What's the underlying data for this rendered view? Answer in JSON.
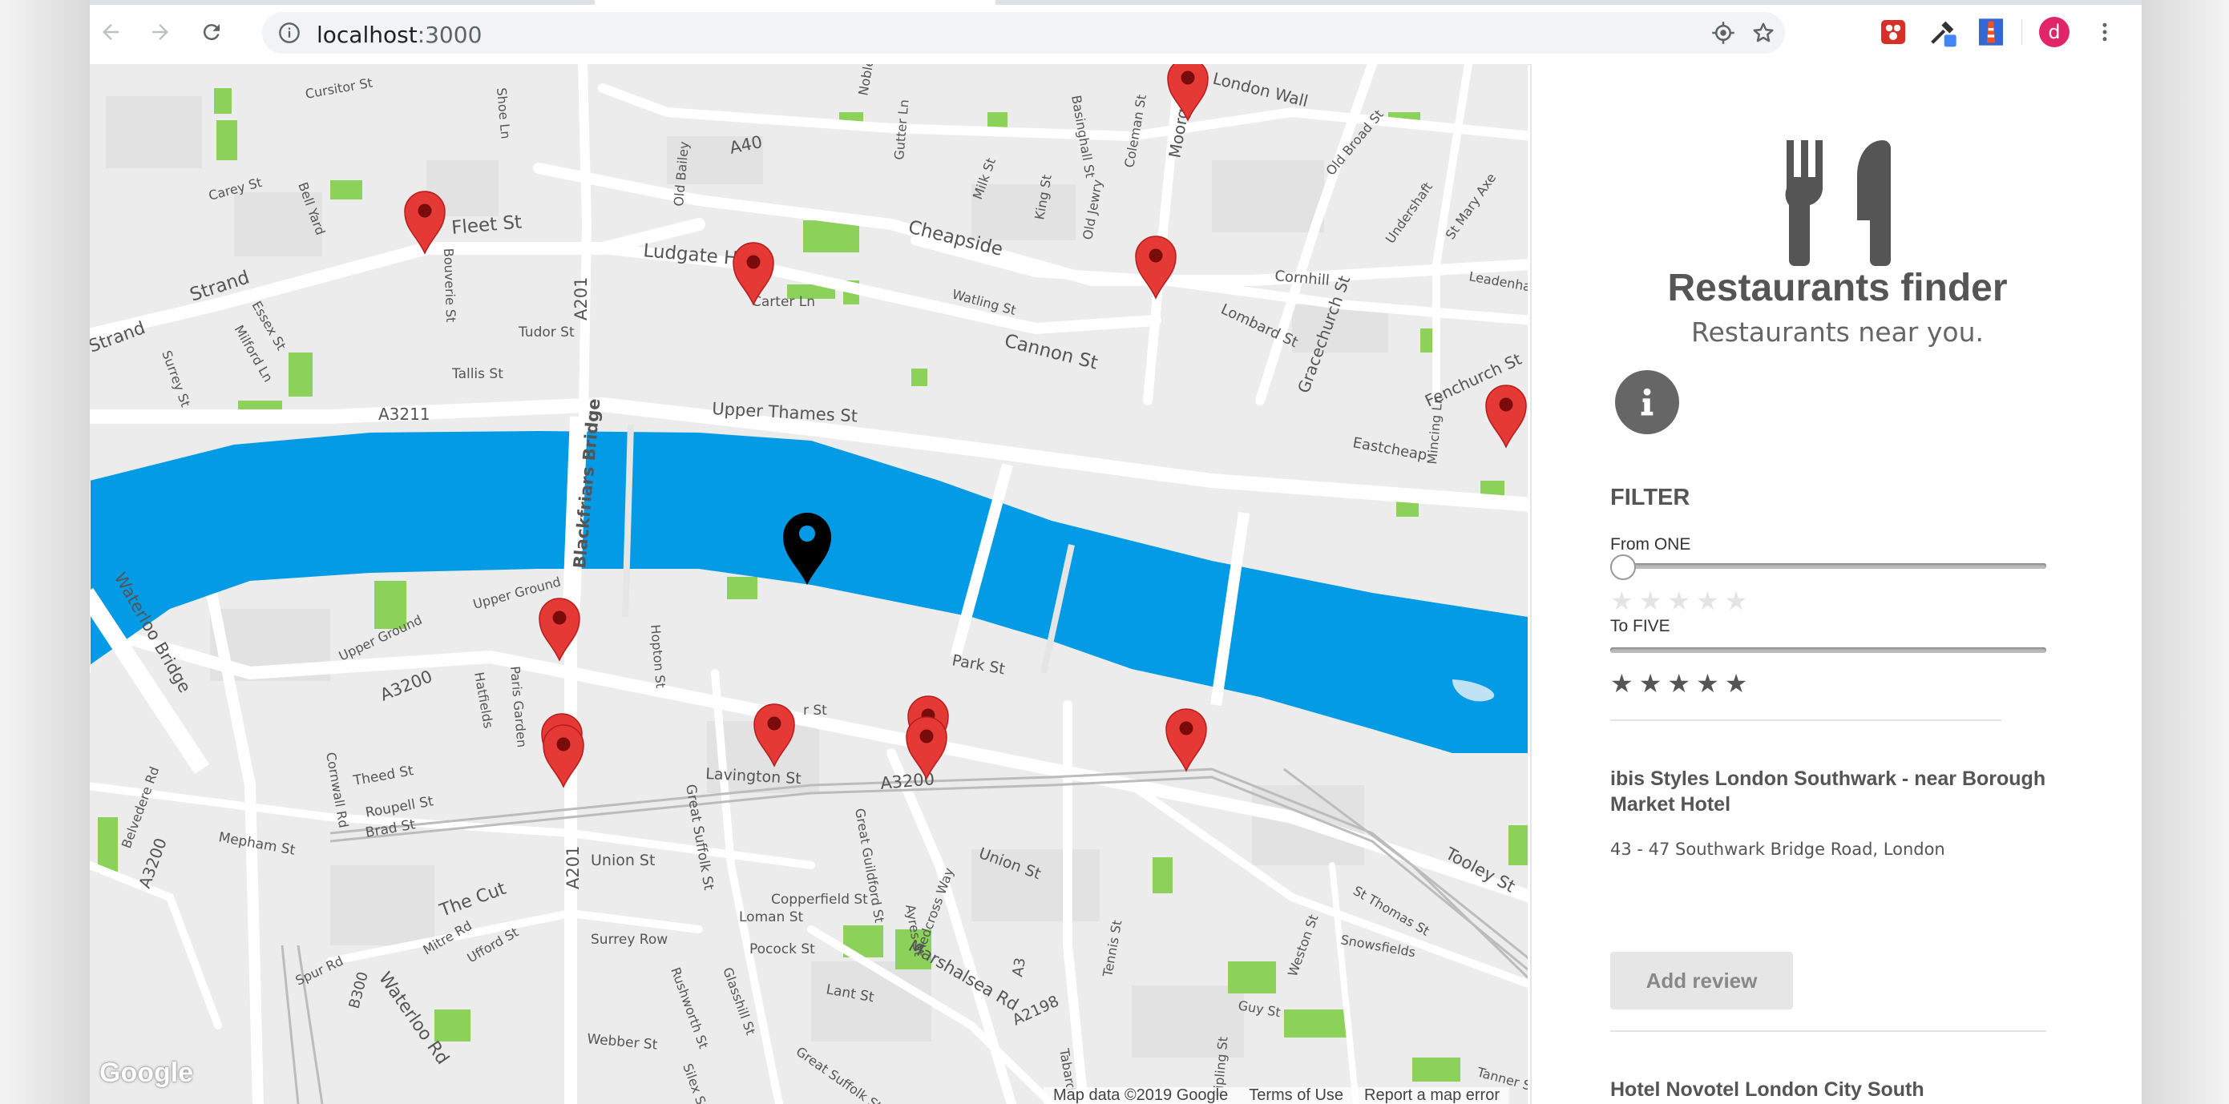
{
  "browser": {
    "url_host": "localhost",
    "url_port": ":3000",
    "avatar_letter": "d",
    "icons": [
      "back-icon",
      "forward-icon",
      "reload-icon",
      "info-icon",
      "location-icon",
      "star-icon",
      "extension-icon",
      "eyedropper-icon",
      "lighthouse-icon",
      "menu-icon"
    ]
  },
  "map": {
    "labels": {
      "fleet": "Fleet St",
      "strand": "Strand",
      "strand2": "Strand",
      "ludgate": "Ludgate Hill",
      "cheapside": "Cheapside",
      "cannon": "Cannon St",
      "upper_thames": "Upper Thames St",
      "a3211": "A3211",
      "a40": "A40",
      "a201": "A201",
      "a201b": "A201",
      "a3200": "A3200",
      "a3200b": "A3200",
      "a3200c": "A3200",
      "fenchurch": "Fenchurch St",
      "gracechurch": "Gracechurch St",
      "moorgate": "Moorgate",
      "london_wall": "London Wall",
      "blackfriars": "Blackfriars Bridge",
      "waterloo_bridge": "Waterloo Bridge",
      "waterloo_rd": "Waterloo Rd",
      "the_cut": "The Cut",
      "union": "Union St",
      "union2": "Union St",
      "park": "Park St",
      "tooley": "Tooley St",
      "marshalsea": "Marshalsea Rd",
      "a2198": "A2198",
      "lavington": "Lavington St",
      "great_suffolk": "Great Suffolk St",
      "cornhill": "Cornhill",
      "eastcheap": "Eastcheap",
      "lombard": "Lombard St",
      "carter": "Carter Ln",
      "tudor": "Tudor St",
      "tallis": "Tallis St",
      "surrey": "Surrey St",
      "cursitor": "Cursitor St",
      "carey": "Carey St",
      "bell_yard": "Bell Yard",
      "shoe": "Shoe Ln",
      "old_bailey": "Old Bailey",
      "gutter": "Gutter Ln",
      "noble": "Noble St",
      "milk": "Milk St",
      "king": "King St",
      "old_jewry": "Old Jewry",
      "coleman": "Coleman St",
      "basinghall": "Basinghall St",
      "old_broad": "Old Broad St",
      "st_mary_axe": "St Mary Axe",
      "undershaft": "Undershaft",
      "leadenhall": "Leadenhall St",
      "mincing": "Mincing Ln",
      "watling": "Watling St",
      "upper_ground": "Upper Ground",
      "upper_ground2": "Upper Ground",
      "hatfields": "Hatfields",
      "paris_garden": "Paris Garden",
      "hopton": "Hopton St",
      "theed": "Theed St",
      "roupell": "Roupell St",
      "brad": "Brad St",
      "cornwall": "Cornwall Rd",
      "belvedere": "Belvedere Rd",
      "mepham": "Mepham St",
      "a3200w": "A3200",
      "mitre": "Mitre Rd",
      "ufford": "Ufford St",
      "spur": "Spur Rd",
      "b300": "B300",
      "webber": "Webber St",
      "copperfield": "Copperfield St",
      "loman": "Loman St",
      "pocock": "Pocock St",
      "surrey_row": "Surrey Row",
      "lant": "Lant St",
      "great_guildford": "Great Guildford St",
      "ayres": "Ayres St",
      "redcross": "Redcross Way",
      "snowsfields": "Snowsfields",
      "st_thomas": "St Thomas St",
      "weston": "Weston St",
      "guy": "Guy St",
      "kipling": "Kipling St",
      "tennis": "Tennis St",
      "tanner": "Tanner St",
      "rushworth": "Rushworth St",
      "glasshill": "Glasshill St",
      "silex": "Silex St",
      "great_suffolk2": "Great Suffolk St",
      "essex": "Essex St",
      "milford": "Milford Ln",
      "bouverie": "Bouverie St",
      "a3": "A3",
      "tabard": "Tabard",
      "o_st": "r St"
    },
    "google_logo": "Google",
    "attribution": {
      "data": "Map data ©2019 Google",
      "terms": "Terms of Use",
      "report": "Report a map error"
    }
  },
  "sidebar": {
    "logo_icon": "utensils-icon",
    "title": "Restaurants finder",
    "subtitle": "Restaurants near you.",
    "filter_heading": "FILTER",
    "from_label": "From ONE",
    "to_label": "To FIVE",
    "from_value": 1,
    "to_value": 5,
    "restaurants": [
      {
        "name": "ibis Styles London Southwark - near Borough Market Hotel",
        "address": "43 - 47 Southwark Bridge Road, London"
      },
      {
        "name": "Hotel Novotel London City South"
      }
    ],
    "add_review": "Add review"
  },
  "colors": {
    "river": "#039be5",
    "marker_red": "#e53935",
    "user_marker": "#000000",
    "park_green": "#8bd15a"
  }
}
